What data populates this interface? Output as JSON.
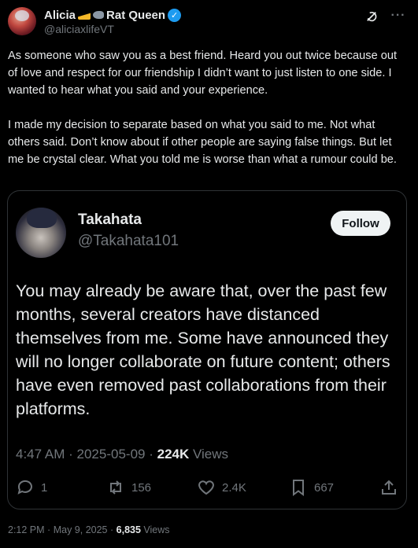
{
  "author": {
    "display_name": "Alicia",
    "name_suffix": "Rat Queen",
    "handle": "@aliciaxlifeVT",
    "verified_icon": "verified-badge-icon"
  },
  "post": {
    "paragraphs": [
      "As someone who saw you as a best friend. Heard you out twice because out of love and respect for our friendship I didn’t want to just listen to one side. I wanted to hear what you said and your experience.",
      "I made my decision to separate based on what you said to me. Not what others said. Don’t know about if other people are saying false things. But let me be crystal clear. What you told me is worse than what a rumour could be."
    ],
    "time": "2:12 PM",
    "sep": "·",
    "date": "May 9, 2025",
    "views_count": "6,835",
    "views_label": "Views"
  },
  "quoted": {
    "display_name": "Takahata",
    "handle": "@Takahata101",
    "follow_label": "Follow",
    "body": "You may already be aware that, over the past few months, several creators have distanced themselves from me. Some have announced they will no longer collaborate on future content; others have even removed past collaborations from their platforms.",
    "time": "4:47 AM",
    "sep": "·",
    "date": "2025-05-09",
    "views_count": "224K",
    "views_label": "Views",
    "replies": "1",
    "reposts": "156",
    "likes": "2.4K",
    "bookmarks": "667"
  },
  "icons": {
    "grok": "grok-icon",
    "more": "more-icon",
    "reply": "reply-icon",
    "repost": "repost-icon",
    "like": "heart-icon",
    "bookmark": "bookmark-icon",
    "share": "share-icon"
  },
  "colors": {
    "background": "#000000",
    "text": "#e7e9ea",
    "muted": "#71767b",
    "border": "#2f3336",
    "verified": "#1d9bf0"
  }
}
